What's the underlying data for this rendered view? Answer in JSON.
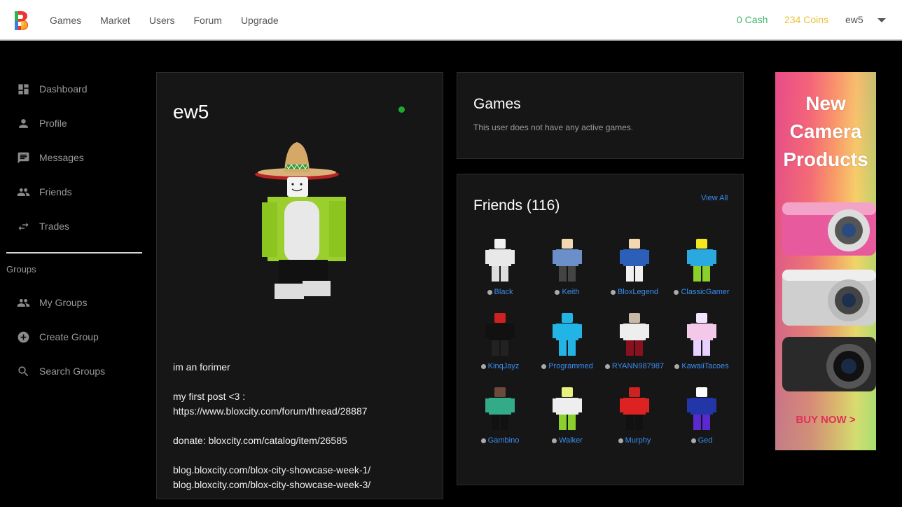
{
  "nav": {
    "items": [
      "Games",
      "Market",
      "Users",
      "Forum",
      "Upgrade"
    ],
    "cash": "0 Cash",
    "coins": "234 Coins",
    "username": "ew5"
  },
  "sidebar": {
    "items": [
      {
        "label": "Dashboard",
        "icon": "dashboard-icon"
      },
      {
        "label": "Profile",
        "icon": "person-icon"
      },
      {
        "label": "Messages",
        "icon": "message-icon"
      },
      {
        "label": "Friends",
        "icon": "people-icon"
      },
      {
        "label": "Trades",
        "icon": "swap-icon"
      }
    ],
    "groups_heading": "Groups",
    "group_items": [
      {
        "label": "My Groups",
        "icon": "people-icon"
      },
      {
        "label": "Create Group",
        "icon": "add-circle-icon"
      },
      {
        "label": "Search Groups",
        "icon": "search-icon"
      }
    ]
  },
  "profile": {
    "username": "ew5",
    "status": "online",
    "bio": [
      "im an forimer",
      "my first post <3 :\nhttps://www.bloxcity.com/forum/thread/28887",
      "donate: bloxcity.com/catalog/item/26585",
      "blog.bloxcity.com/blox-city-showcase-week-1/\nblog.bloxcity.com/blox-city-showcase-week-3/"
    ]
  },
  "games": {
    "title": "Games",
    "empty_text": "This user does not have any active games."
  },
  "friends": {
    "title": "Friends (116)",
    "view_all": "View All",
    "list": [
      "Black",
      "Keith",
      "BloxLegend",
      "ClassicGamer",
      "KinqJayz",
      "Programmed",
      "RYANN987987",
      "KawaiiTacoes",
      "Gambino",
      "Walker",
      "Murphy",
      "Ged"
    ]
  },
  "ad": {
    "title_lines": [
      "New",
      "Camera",
      "Products"
    ],
    "cta": "BUY NOW >"
  },
  "colors": {
    "cash": "#3fb66a",
    "coins": "#e8c23a",
    "link": "#3a8ef0",
    "online": "#1faa2d"
  }
}
